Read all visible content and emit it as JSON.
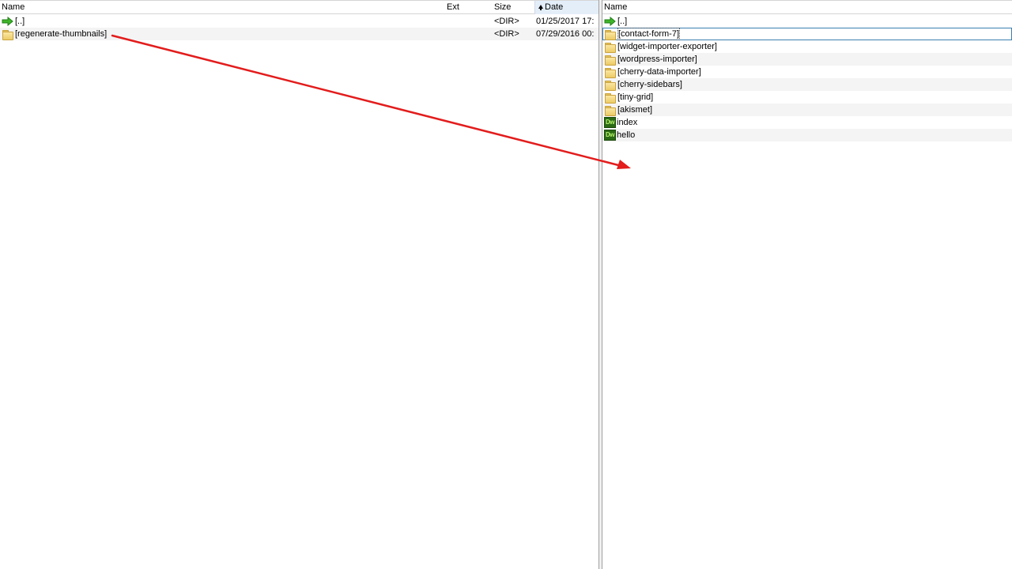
{
  "left_panel": {
    "columns": {
      "name": "Name",
      "ext": "Ext",
      "size": "Size",
      "date": "Date"
    },
    "rows": [
      {
        "name": "[..]",
        "icon": "up-arrow-icon",
        "ext": "",
        "size": "<DIR>",
        "date": "01/25/2017 17:"
      },
      {
        "name": "[regenerate-thumbnails]",
        "icon": "folder-icon",
        "ext": "",
        "size": "<DIR>",
        "date": "07/29/2016 00:"
      }
    ]
  },
  "right_panel": {
    "columns": {
      "name": "Name"
    },
    "rows": [
      {
        "name": "[..]",
        "icon": "up-arrow-icon"
      },
      {
        "name": "[contact-form-7]",
        "icon": "folder-icon"
      },
      {
        "name": "[widget-importer-exporter]",
        "icon": "folder-icon"
      },
      {
        "name": "[wordpress-importer]",
        "icon": "folder-icon"
      },
      {
        "name": "[cherry-data-importer]",
        "icon": "folder-icon"
      },
      {
        "name": "[cherry-sidebars]",
        "icon": "folder-icon"
      },
      {
        "name": "[tiny-grid]",
        "icon": "folder-icon"
      },
      {
        "name": "[akismet]",
        "icon": "folder-icon"
      },
      {
        "name": "index",
        "icon": "dreamweaver-file-icon",
        "icon_text": "Dw"
      },
      {
        "name": "hello",
        "icon": "dreamweaver-file-icon",
        "icon_text": "Dw"
      }
    ]
  },
  "annotation": {
    "color": "#e31c1c"
  },
  "colors": {
    "sorted_header": "#e3eef9",
    "alt_row": "#f4f4f4",
    "focus_border": "#3c7fb1"
  }
}
